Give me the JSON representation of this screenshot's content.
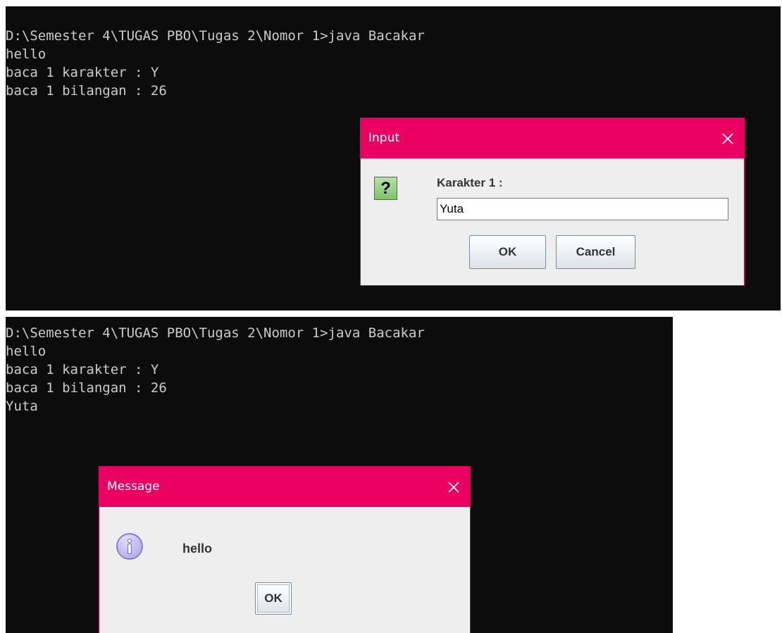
{
  "console_top": {
    "lines": [
      "D:\\Semester 4\\TUGAS PBO\\Tugas 2\\Nomor 1>java Bacakar",
      "hello",
      "baca 1 karakter : Y",
      "baca 1 bilangan : 26"
    ]
  },
  "input_dialog": {
    "title": "Input",
    "close_icon": "close-icon",
    "question_icon": "question-icon",
    "question_glyph": "?",
    "prompt": "Karakter 1 :",
    "input_value": "Yuta",
    "ok_label": "OK",
    "cancel_label": "Cancel"
  },
  "console_bottom": {
    "lines": [
      "D:\\Semester 4\\TUGAS PBO\\Tugas 2\\Nomor 1>java Bacakar",
      "hello",
      "baca 1 karakter : Y",
      "baca 1 bilangan : 26",
      "Yuta"
    ]
  },
  "message_dialog": {
    "title": "Message",
    "close_icon": "close-icon",
    "info_icon": "information-icon",
    "message": "hello",
    "ok_label": "OK"
  },
  "colors": {
    "console_bg": "#0c0c0c",
    "console_text": "#cccccc",
    "titlebar_accent": "#ea0060",
    "dialog_bg": "#eeeeee"
  }
}
